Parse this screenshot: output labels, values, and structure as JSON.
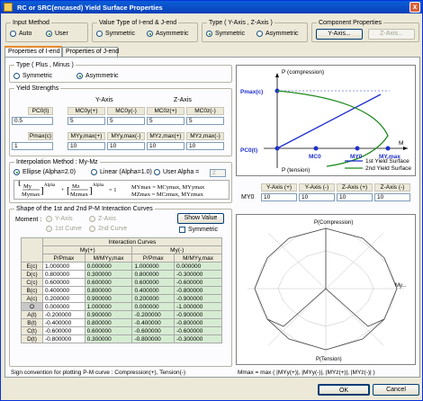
{
  "window": {
    "title": "RC or SRC(encased) Yield Surface Properties",
    "close": "x"
  },
  "input_method": {
    "label": "Input Method",
    "auto": "Auto",
    "user": "User"
  },
  "value_type": {
    "label": "Value Type of I-end & J-end",
    "symmetric": "Symmetric",
    "asymmetric": "Asymmetric"
  },
  "type_axis": {
    "label": "Type ( Y-Axis , Z-Axis )",
    "symmetric": "Symmetric",
    "asymmetric": "Asymmetric"
  },
  "component": {
    "label": "Component Properties",
    "y_axis": "Y-Axis...",
    "z_axis": "Z-Axis..."
  },
  "tabs": [
    "Properties of I-end",
    "Properties of J-end"
  ],
  "type_pm": {
    "label": "Type ( Plus , Minus )",
    "symmetric": "Symmetric",
    "asymmetric": "Asymmetric"
  },
  "yield": {
    "label": "Yield Strengths",
    "y_axis": "Y-Axis",
    "z_axis": "Z-Axis",
    "h1": [
      "PC0(t)",
      "MC0y(+)",
      "MC0y(-)",
      "MC0z(+)",
      "MC0z(-)"
    ],
    "v1": [
      "0.5",
      "5",
      "5",
      "5",
      "5"
    ],
    "h2": [
      "Pmax(c)",
      "MYy,max(+)",
      "MYy,max(-)",
      "MYz,max(+)",
      "MYz,max(-)"
    ],
    "v2": [
      "1",
      "10",
      "10",
      "10",
      "10"
    ]
  },
  "interp": {
    "label": "Interpolation Method : My-Mz",
    "ellipse": "Ellipse (Alpha=2.0)",
    "linear": "Linear (Alpha=1.0)",
    "user_alpha": "User Alpha =",
    "alpha_value": "2",
    "formula": {
      "my": "My",
      "mymax": "Mymax",
      "mz": "Mz",
      "mzmax": "Mzmax",
      "alpha": "Alpha",
      "plus": "+",
      "eq": "= 1",
      "l1": "MYmax = MCymax, MYymax",
      "l2": "MZmax = MCzmax, MYzmax"
    }
  },
  "chart1": {
    "y_top": "P (compression)",
    "y_bottom": "P (tension)",
    "pmax": "Pmax(c)",
    "pc0": "PC0(t)",
    "mc0": "MC0",
    "my0": "MY0",
    "mymax": "MY,max",
    "m": "M",
    "legend1": "1st Yield Surface",
    "legend2": "2nd Yield Surface",
    "color1": "#1f2fd0",
    "color2": "#1e8a1e"
  },
  "my0": {
    "label": "MY0",
    "headers": [
      "Y-Axis (+)",
      "Y-Axis (-)",
      "Z-Axis (+)",
      "Z-Axis (-)"
    ],
    "values": [
      "10",
      "10",
      "10",
      "10"
    ]
  },
  "shape": {
    "label": "Shape of the 1st and 2nd P-M Interaction Curves",
    "moment": "Moment :",
    "y_axis": "Y-Axis",
    "z_axis": "Z-Axis",
    "first": "1st Curve",
    "second": "2nd Curve",
    "show_value": "Show Value",
    "symmetric": "Symmetric"
  },
  "curves": {
    "title": "Interaction Curves",
    "mplus": "My(+)",
    "mminus": "My(-)",
    "cols": [
      "P/Pmax",
      "M/MYy,max",
      "P/Pmax",
      "M/MYy,max"
    ],
    "rows": [
      {
        "label": "E(c)",
        "v": [
          "1.000000",
          "0.000000",
          "1.000000",
          "0.000000"
        ]
      },
      {
        "label": "D(c)",
        "v": [
          "0.800000",
          "0.300000",
          "0.800000",
          "-0.300000"
        ]
      },
      {
        "label": "C(c)",
        "v": [
          "0.600000",
          "0.600000",
          "0.600000",
          "-0.600000"
        ]
      },
      {
        "label": "B(c)",
        "v": [
          "0.400000",
          "0.800000",
          "0.400000",
          "-0.800000"
        ]
      },
      {
        "label": "A(c)",
        "v": [
          "0.200000",
          "0.900000",
          "0.200000",
          "-0.900000"
        ]
      },
      {
        "label": "O",
        "v": [
          "0.000000",
          "1.000000",
          "0.000000",
          "-1.000000"
        ]
      },
      {
        "label": "A(t)",
        "v": [
          "-0.200000",
          "0.900000",
          "-0.200000",
          "-0.900000"
        ]
      },
      {
        "label": "B(t)",
        "v": [
          "-0.400000",
          "0.800000",
          "-0.400000",
          "-0.800000"
        ]
      },
      {
        "label": "C(t)",
        "v": [
          "-0.600000",
          "0.600000",
          "-0.600000",
          "-0.600000"
        ]
      },
      {
        "label": "D(t)",
        "v": [
          "-0.800000",
          "0.300000",
          "-0.800000",
          "-0.300000"
        ]
      }
    ]
  },
  "chart2": {
    "top": "P(Compression)",
    "bottom": "P(Tension)",
    "right": "My..."
  },
  "sign_note": "Sign convention for plotting P-M curve : Compression(+), Tension(-)",
  "mmax_note": "Mmax = max ( |MYy(+)|, |MYy(-)|, |MYz(+)|, |MYz(-)| )",
  "ok": "OK",
  "cancel": "Cancel"
}
